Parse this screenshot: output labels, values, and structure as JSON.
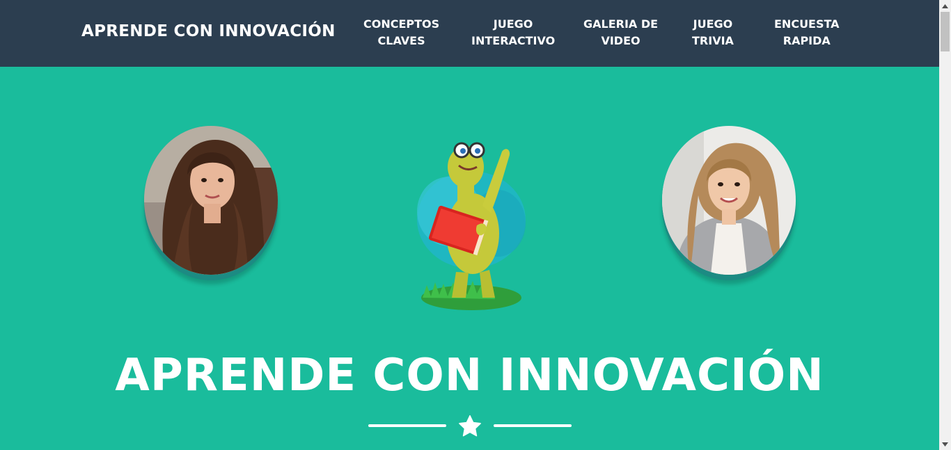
{
  "navbar": {
    "brand": "APRENDE CON INNOVACIÓN",
    "items": [
      {
        "line1": "CONCEPTOS",
        "line2": "CLAVES"
      },
      {
        "line1": "JUEGO",
        "line2": "INTERACTIVO"
      },
      {
        "line1": "GALERIA DE",
        "line2": "VIDEO"
      },
      {
        "line1": "JUEGO",
        "line2": "TRIVIA"
      },
      {
        "line1": "ENCUESTA",
        "line2": "RAPIDA"
      }
    ]
  },
  "hero": {
    "title": "APRENDE CON INNOVACIÓN",
    "divider_icon": "star-icon"
  },
  "images": {
    "left_avatar": "portrait-photo",
    "mascot": "turtle-mascot-with-book",
    "right_avatar": "portrait-photo"
  },
  "colors": {
    "navbar": "#2c3e50",
    "background": "#1abc9c",
    "text": "#ffffff"
  }
}
